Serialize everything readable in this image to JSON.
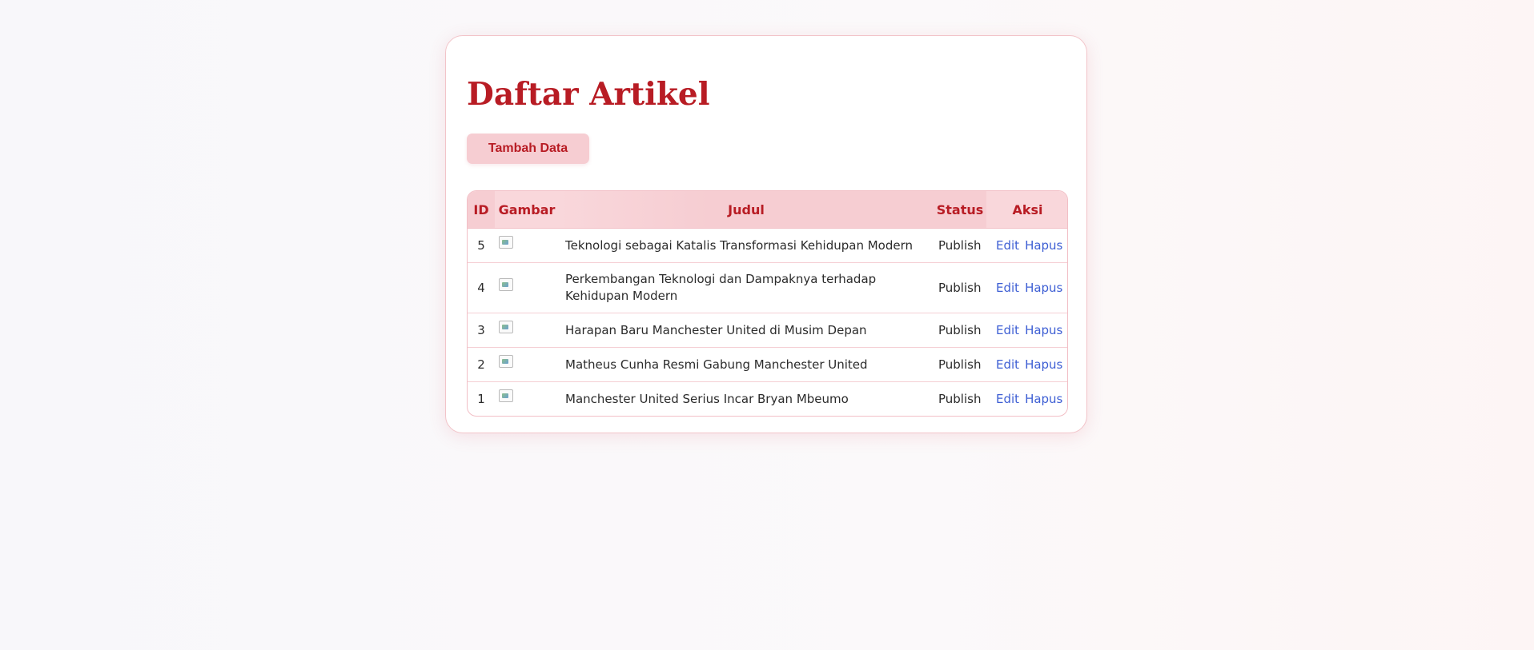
{
  "page": {
    "title": "Daftar Artikel",
    "add_button_label": "Tambah Data"
  },
  "table": {
    "headers": {
      "id": "ID",
      "gambar": "Gambar",
      "judul": "Judul",
      "status": "Status",
      "aksi": "Aksi"
    },
    "rows": [
      {
        "id": "5",
        "judul": "Teknologi sebagai Katalis Transformasi Kehidupan Modern",
        "status": "Publish",
        "edit": "Edit",
        "hapus": "Hapus"
      },
      {
        "id": "4",
        "judul": "Perkembangan Teknologi dan Dampaknya terhadap Kehidupan Modern",
        "status": "Publish",
        "edit": "Edit",
        "hapus": "Hapus"
      },
      {
        "id": "3",
        "judul": "Harapan Baru Manchester United di Musim Depan",
        "status": "Publish",
        "edit": "Edit",
        "hapus": "Hapus"
      },
      {
        "id": "2",
        "judul": "Matheus Cunha Resmi Gabung Manchester United",
        "status": "Publish",
        "edit": "Edit",
        "hapus": "Hapus"
      },
      {
        "id": "1",
        "judul": "Manchester United Serius Incar Bryan Mbeumo",
        "status": "Publish",
        "edit": "Edit",
        "hapus": "Hapus"
      }
    ]
  },
  "colors": {
    "accent": "#b81c24",
    "header_bg": "#f6cdd2",
    "link": "#3e5fd4",
    "border": "#f2bfc6"
  },
  "icons": {
    "row_image": "broken-image-icon"
  }
}
